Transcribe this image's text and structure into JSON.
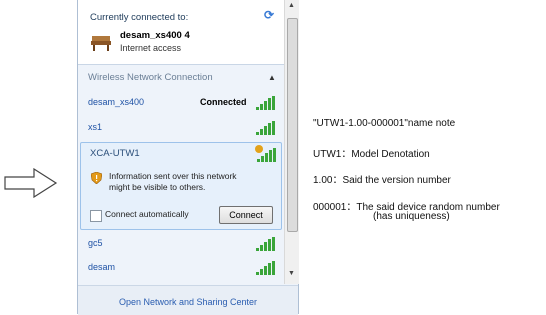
{
  "flyout": {
    "connected_label": "Currently connected to:",
    "current": {
      "name": "desam_xs400  4",
      "status": "Internet access"
    },
    "section_title": "Wireless Network Connection",
    "networks": [
      {
        "name": "desam_xs400",
        "status": "Connected"
      },
      {
        "name": "xs1"
      },
      {
        "name": "gc5"
      },
      {
        "name": "desam"
      }
    ],
    "selected": {
      "name": "XCA-UTW1",
      "warning": "Information sent over this network might be visible to others.",
      "auto_connect_label": "Connect automatically",
      "connect_button": "Connect"
    },
    "footer_link": "Open Network and Sharing Center"
  },
  "annotations": [
    "\"UTW1-1.00-000001\"name note",
    "UTW1：Model Denotation",
    "1.00：Said the version number",
    "000001：The said device random number",
    "(has uniqueness)"
  ],
  "colors": {
    "accent": "#1f52a5",
    "signal": "#3aa53a",
    "panel_bg": "#eef3fa"
  }
}
